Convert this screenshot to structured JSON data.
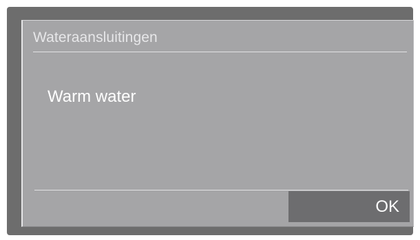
{
  "dialog": {
    "title": "Wateraansluitingen",
    "message": "Warm water",
    "ok_label": "OK"
  },
  "colors": {
    "bezel": "#6d6d6d",
    "screen": "#a5a5a7",
    "button": "#6d6d6f",
    "text": "#ffffff"
  }
}
